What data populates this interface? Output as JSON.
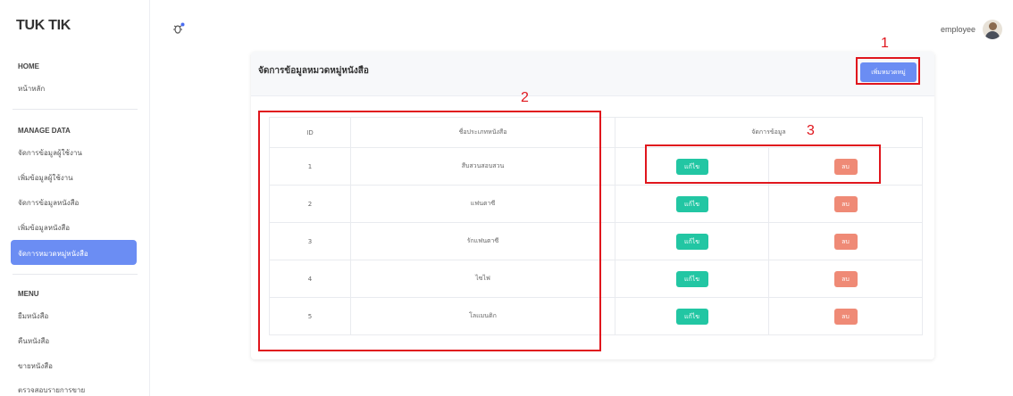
{
  "brand": "TUK TIK",
  "sidebar": {
    "sections": [
      {
        "title": "HOME",
        "items": [
          "หน้าหลัก"
        ]
      },
      {
        "title": "MANAGE DATA",
        "items": [
          "จัดการข้อมูลผู้ใช้งาน",
          "เพิ่มข้อมูลผู้ใช้งาน",
          "จัดการข้อมูลหนังสือ",
          "เพิ่มข้อมูลหนังสือ",
          "จัดการหมวดหมู่หนังสือ"
        ]
      },
      {
        "title": "MENU",
        "items": [
          "ยืมหนังสือ",
          "คืนหนังสือ",
          "ขายหนังสือ",
          "ตรวจสอบรายการขาย"
        ]
      }
    ],
    "active_item": "จัดการหมวดหมู่หนังสือ"
  },
  "topbar": {
    "icon": "bug-icon",
    "user_name": "employee"
  },
  "card": {
    "title": "จัดการข้อมูลหมวดหมู่หนังสือ",
    "add_button": "เพิ่มหมวดหมู่"
  },
  "table": {
    "headers": {
      "id": "ID",
      "name": "ชื่อประเภทหนังสือ",
      "actions": "จัดการข้อมูล"
    },
    "rows": [
      {
        "id": "1",
        "name": "สืบสวนสอบสวน"
      },
      {
        "id": "2",
        "name": "แฟนตาซี"
      },
      {
        "id": "3",
        "name": "รักแฟนตาซี"
      },
      {
        "id": "4",
        "name": "ไซไฟ"
      },
      {
        "id": "5",
        "name": "โลแมนติก"
      }
    ],
    "edit_label": "แก้ไข",
    "delete_label": "ลบ"
  },
  "annotations": {
    "m1": "1",
    "m2": "2",
    "m3": "3"
  },
  "colors": {
    "accent": "#6b8df3",
    "edit": "#22c6a3",
    "delete": "#ef8a76",
    "annotation": "#e0161d"
  }
}
